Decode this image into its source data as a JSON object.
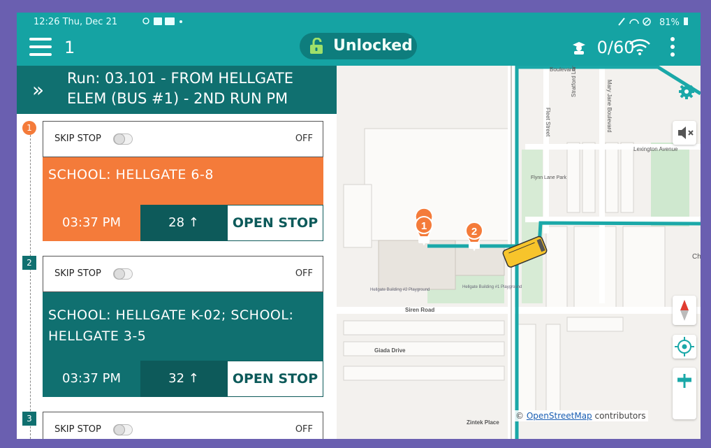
{
  "status_bar": {
    "time_date": "12:26  Thu, Dec 21",
    "status_icons": "location-icon image-icon sim-icon",
    "right": "81%"
  },
  "app_bar": {
    "menu_count": "1",
    "lock_label": "Unlocked",
    "riders_count": "0/60"
  },
  "run": {
    "prefix": "Run: ",
    "title": "03.101 - FROM HELLGATE ELEM (BUS #1) - 2ND RUN PM"
  },
  "stops": [
    {
      "number": "1",
      "skip_label": "SKIP STOP",
      "skip_state": "OFF",
      "school": "SCHOOL:  HELLGATE 6-8",
      "time": "03:37 PM",
      "count": "28 ↑",
      "open_label": "OPEN STOP",
      "color": "#f47b3a"
    },
    {
      "number": "2",
      "skip_label": "SKIP STOP",
      "skip_state": "OFF",
      "school": "SCHOOL:  HELLGATE K-02; SCHOOL: HELLGATE 3-5",
      "time": "03:37 PM",
      "count": "32 ↑",
      "open_label": "OPEN STOP",
      "color": "#107070"
    },
    {
      "number": "3",
      "skip_label": "SKIP STOP",
      "skip_state": "OFF"
    }
  ],
  "map": {
    "streets": {
      "boulevard": "Boulevard",
      "fleet": "Fleet Street",
      "stratford": "Stratford Lane",
      "maryjane": "Mary Jane Boulevard",
      "lexington": "Lexington Avenue",
      "siren": "Siren Road",
      "giada": "Giada Drive",
      "zintek": "Zintek Place",
      "ch": "Ch",
      "flynn": "Flynn Lane Park",
      "pg2": "Hellgate Building #2 Playground",
      "pg1": "Hellgate Building #1 Playground"
    },
    "attribution_prefix": "© ",
    "attribution_link": "OpenStreetMap",
    "attribution_suffix": " contributors",
    "marker1": "1",
    "marker2": "2",
    "controls": [
      "gear-icon",
      "mute-icon",
      "compass-icon",
      "locate-icon",
      "zoom-in-icon",
      "zoom-out-icon"
    ],
    "route_color": "#1aa8a8"
  },
  "colors": {
    "teal": "#15a3a3",
    "dark_teal": "#107070",
    "orange": "#f47b3a"
  }
}
